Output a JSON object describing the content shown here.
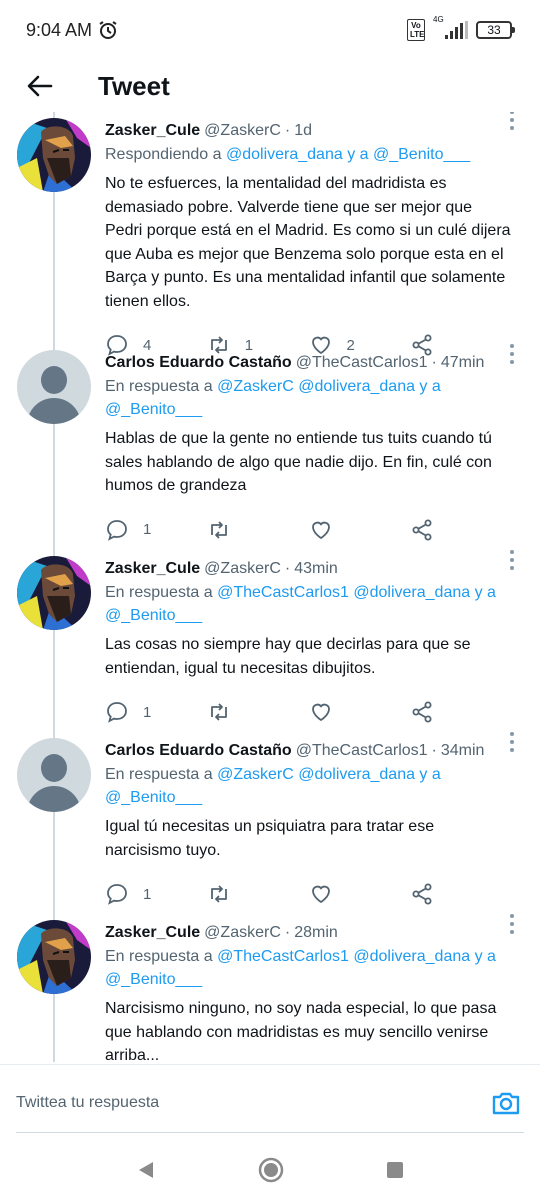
{
  "status": {
    "time": "9:04 AM",
    "volte_top": "Vo",
    "volte_bottom": "LTE",
    "network": "4G",
    "battery": "33"
  },
  "header": {
    "title": "Tweet"
  },
  "tweets": [
    {
      "name": "Zasker_Cule",
      "handle": "@ZaskerC",
      "time": "1d",
      "reply_prefix": "Respondiendo a ",
      "reply_mentions": "@dolivera_dana y a @_Benito___",
      "text": "No te esfuerces, la mentalidad del madridista es demasiado pobre. Valverde tiene que ser mejor que Pedri porque está en el Madrid. Es como si un culé dijera que Auba es mejor que Benzema solo porque esta en el Barça y punto. Es una mentalidad infantil que solamente tienen ellos.",
      "replies": "4",
      "retweets": "1",
      "likes": "2"
    },
    {
      "name": "Carlos Eduardo Castaño",
      "handle": "@TheCastCarlos1",
      "time": "47min",
      "reply_prefix": "En respuesta a ",
      "reply_mentions": "@ZaskerC @dolivera_dana y a @_Benito___",
      "text": "Hablas de que la gente no entiende tus tuits cuando tú sales hablando de algo que nadie dijo. En fin, culé con humos de grandeza",
      "replies": "1",
      "retweets": "",
      "likes": ""
    },
    {
      "name": "Zasker_Cule",
      "handle": "@ZaskerC",
      "time": "43min",
      "reply_prefix": "En respuesta a ",
      "reply_mentions": "@TheCastCarlos1 @dolivera_dana y a @_Benito___",
      "text": "Las cosas no siempre hay que decirlas para que se entiendan, igual tu necesitas dibujitos.",
      "replies": "1",
      "retweets": "",
      "likes": ""
    },
    {
      "name": "Carlos Eduardo Castaño",
      "handle": "@TheCastCarlos1",
      "time": "34min",
      "reply_prefix": "En respuesta a ",
      "reply_mentions": "@ZaskerC @dolivera_dana y a @_Benito___",
      "text": "Igual tú necesitas un psiquiatra para tratar ese narcisismo tuyo.",
      "replies": "1",
      "retweets": "",
      "likes": ""
    },
    {
      "name": "Zasker_Cule",
      "handle": "@ZaskerC",
      "time": "28min",
      "reply_prefix": "En respuesta a ",
      "reply_mentions": "@TheCastCarlos1 @dolivera_dana y a @_Benito___",
      "text": "Narcisismo ninguno, no soy nada especial, lo que pasa que hablando con madridistas es muy sencillo venirse arriba...",
      "replies": "",
      "retweets": "",
      "likes": ""
    }
  ],
  "reply_box": {
    "placeholder": "Twittea tu respuesta"
  },
  "colors": {
    "accent": "#1d9bf0",
    "secondary_text": "#536471",
    "thread_line": "#cfd9de"
  }
}
